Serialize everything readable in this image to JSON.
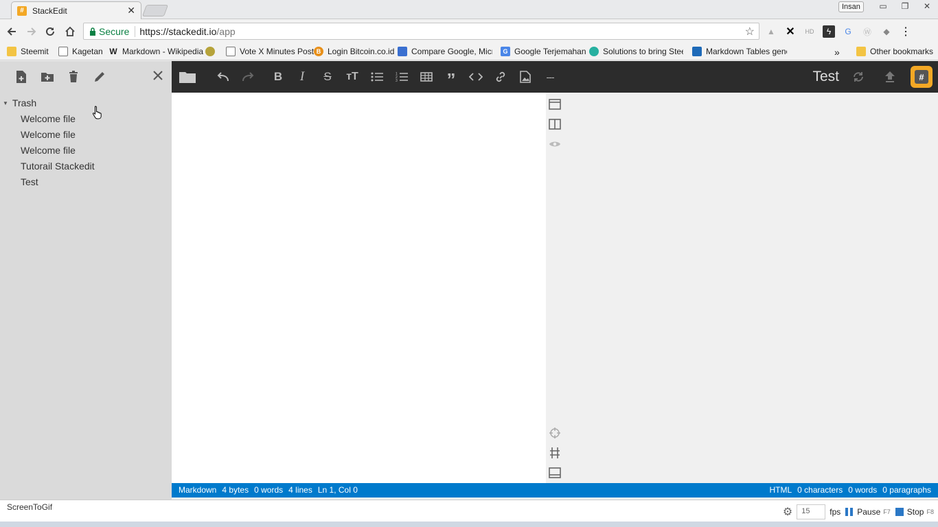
{
  "browser": {
    "tab_title": "StackEdit",
    "tab_favicon": "#",
    "profile_name": "Insan",
    "secure_label": "Secure",
    "url_host": "https://stackedit.io",
    "url_path": "/app",
    "bookmarks": [
      {
        "label": "Steemit",
        "icon": "folder-icon",
        "color": "#f3c444"
      },
      {
        "label": "Kagetan",
        "icon": "page-icon",
        "color": "#ffffff"
      },
      {
        "label": "Markdown - Wikipedia",
        "icon": "wikipedia-icon",
        "color": "#ffffff"
      },
      {
        "label": "",
        "icon": "pepe-icon",
        "color": "#b6a33a"
      },
      {
        "label": "Vote X Minutes Post",
        "icon": "page-icon",
        "color": "#ffffff"
      },
      {
        "label": "Login Bitcoin.co.id",
        "icon": "bitcoin-icon",
        "color": "#e8901a"
      },
      {
        "label": "Compare Google, Micro",
        "icon": "map-icon",
        "color": "#3a6fd0"
      },
      {
        "label": "Google Terjemahan",
        "icon": "translate-icon",
        "color": "#4a86e8"
      },
      {
        "label": "Solutions to bring Steem",
        "icon": "steem-icon",
        "color": "#27b0a0"
      },
      {
        "label": "Markdown Tables gener",
        "icon": "table-icon",
        "color": "#1e6ab8"
      },
      {
        "label": "Other bookmarks",
        "icon": "folder-icon",
        "color": "#f3c444"
      }
    ],
    "bookmarks_overflow": "»"
  },
  "explorer": {
    "folder_name": "Trash",
    "files": [
      "Welcome file",
      "Welcome file",
      "Welcome file",
      "Tutorail Stackedit",
      "Test"
    ]
  },
  "navbar": {
    "doc_title": "Test",
    "logo_glyph": "#",
    "hr_label": "---"
  },
  "status": {
    "left": {
      "mode": "Markdown",
      "bytes_value": "4",
      "bytes_label": "bytes",
      "words_value": "0",
      "words_label": "words",
      "lines_value": "4",
      "lines_label": "lines",
      "cursor": "Ln 1, Col 0"
    },
    "right": {
      "mode": "HTML",
      "chars_value": "0",
      "chars_label": "characters",
      "words_value": "0",
      "words_label": "words",
      "paragraphs_value": "0",
      "paragraphs_label": "paragraphs"
    }
  },
  "recorder": {
    "title": "ScreenToGif",
    "fps_value": "15",
    "fps_label": "fps",
    "pause_label": "Pause",
    "pause_key": "F7",
    "stop_label": "Stop",
    "stop_key": "F8"
  },
  "colors": {
    "accent_blue": "#007acc",
    "navbar_bg": "#2c2c2c",
    "sidebar_bg": "#dadada",
    "logo_orange": "#f3a825"
  }
}
